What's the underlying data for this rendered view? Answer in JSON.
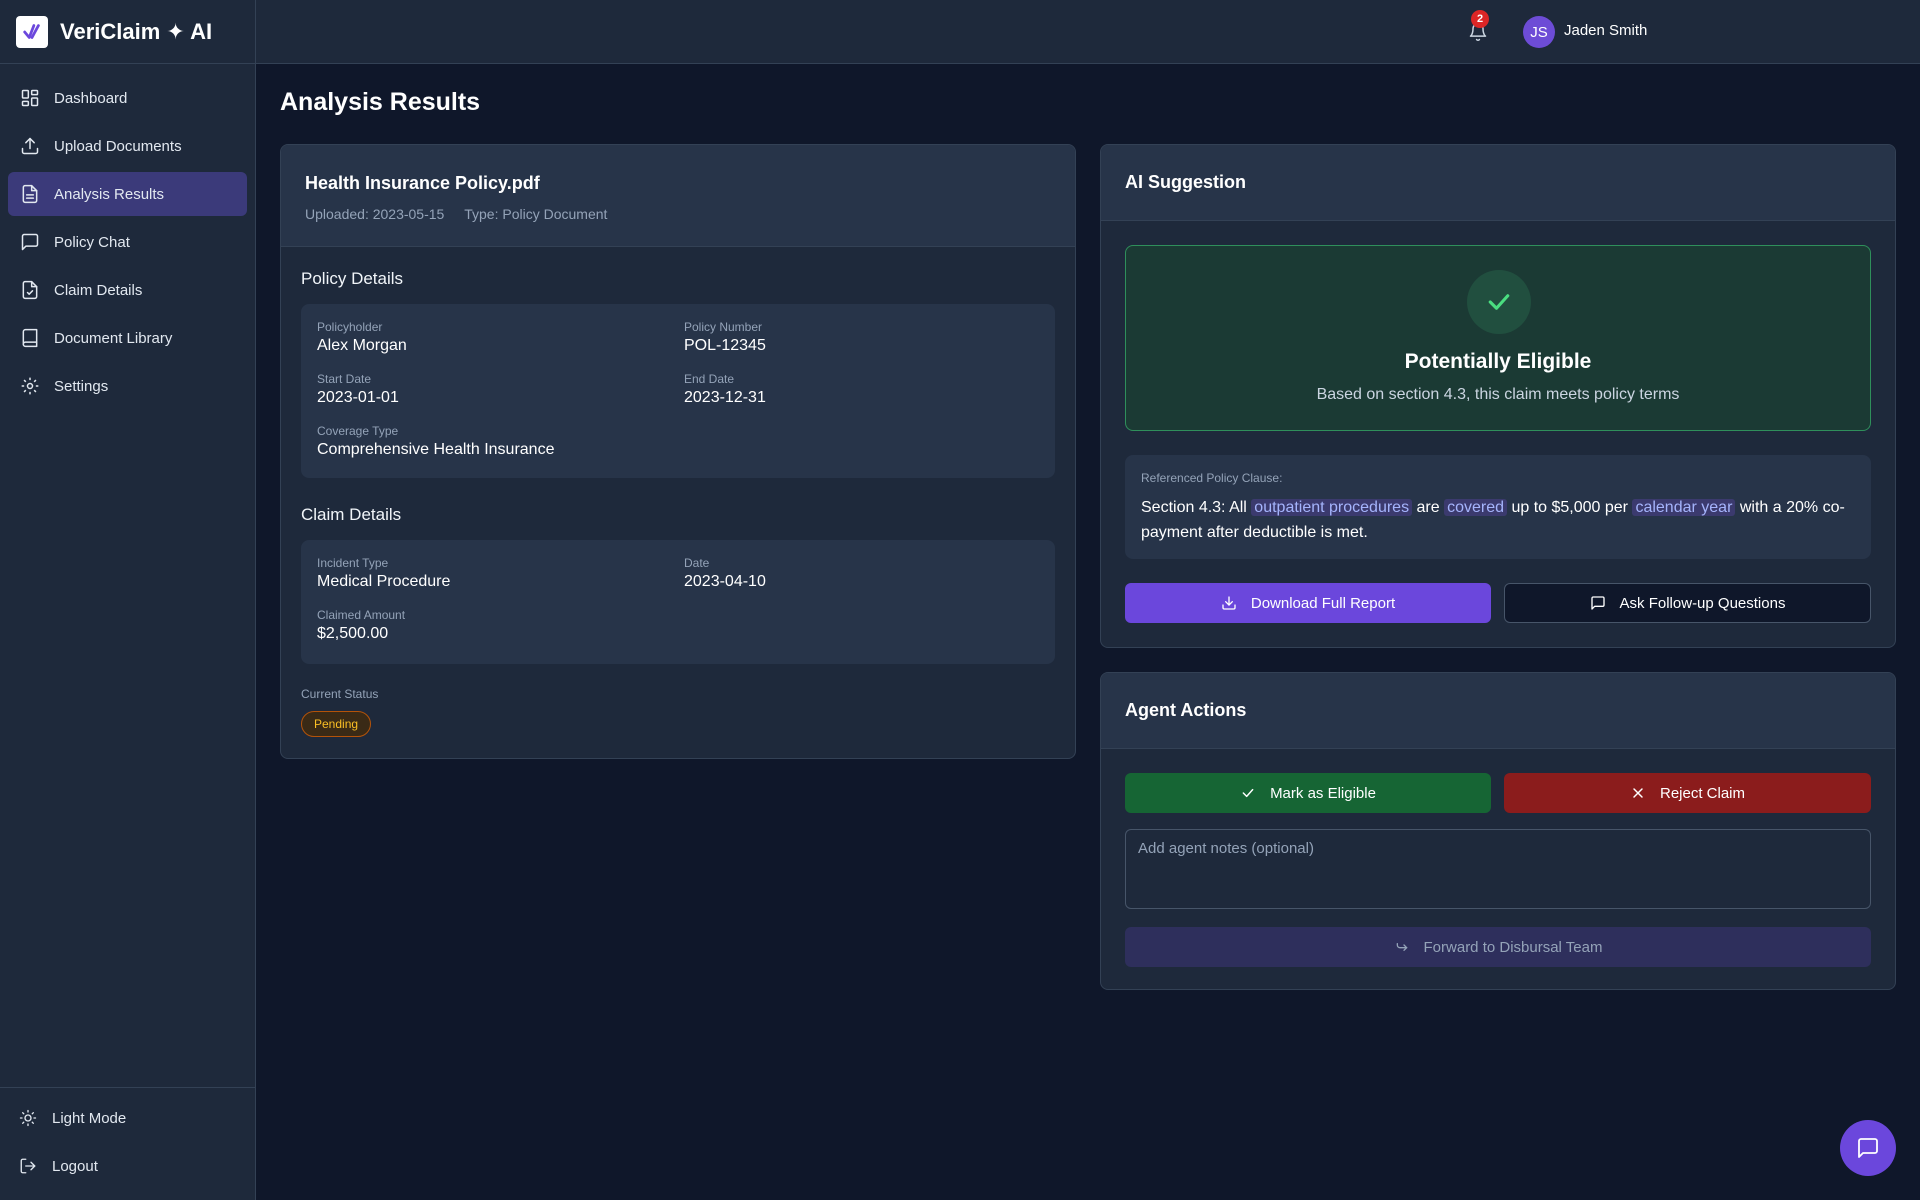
{
  "app": {
    "name": "VeriClaim ✦ AI"
  },
  "sidebar": {
    "items": [
      {
        "label": "Dashboard"
      },
      {
        "label": "Upload Documents"
      },
      {
        "label": "Analysis Results"
      },
      {
        "label": "Policy Chat"
      },
      {
        "label": "Claim Details"
      },
      {
        "label": "Document Library"
      },
      {
        "label": "Settings"
      }
    ],
    "bottom": [
      {
        "label": "Light Mode"
      },
      {
        "label": "Logout"
      }
    ]
  },
  "header": {
    "notification_count": "2",
    "user_initials": "JS",
    "user_name": "Jaden Smith"
  },
  "page": {
    "title": "Analysis Results"
  },
  "document": {
    "name": "Health Insurance Policy.pdf",
    "uploaded": "Uploaded: 2023-05-15",
    "type": "Type: Policy Document"
  },
  "policy_details": {
    "heading": "Policy Details",
    "policyholder_label": "Policyholder",
    "policyholder": "Alex Morgan",
    "policy_number_label": "Policy Number",
    "policy_number": "POL-12345",
    "start_date_label": "Start Date",
    "start_date": "2023-01-01",
    "end_date_label": "End Date",
    "end_date": "2023-12-31",
    "coverage_type_label": "Coverage Type",
    "coverage_type": "Comprehensive Health Insurance"
  },
  "claim_details": {
    "heading": "Claim Details",
    "incident_type_label": "Incident Type",
    "incident_type": "Medical Procedure",
    "date_label": "Date",
    "date": "2023-04-10",
    "claimed_amount_label": "Claimed Amount",
    "claimed_amount": "$2,500.00"
  },
  "status": {
    "label": "Current Status",
    "value": "Pending"
  },
  "ai_suggestion": {
    "title": "AI Suggestion",
    "verdict": "Potentially Eligible",
    "reason": "Based on section 4.3, this claim meets policy terms",
    "clause_label": "Referenced Policy Clause:",
    "clause": {
      "p1": "Section 4.3: All ",
      "h1": "outpatient procedures",
      "p2": " are ",
      "h2": "covered",
      "p3": " up to $5,000 per ",
      "h3": "calendar year",
      "p4": " with a 20% co-payment after deductible is met."
    },
    "download_label": "Download Full Report",
    "followup_label": "Ask Follow-up Questions"
  },
  "agent_actions": {
    "title": "Agent Actions",
    "eligible_label": "Mark as Eligible",
    "reject_label": "Reject Claim",
    "notes_placeholder": "Add agent notes (optional)",
    "forward_label": "Forward to Disbursal Team"
  },
  "colors": {
    "accent": "#6b47dc",
    "success": "#166534",
    "danger": "#8b1c1c",
    "pending": "#fbbf24"
  }
}
